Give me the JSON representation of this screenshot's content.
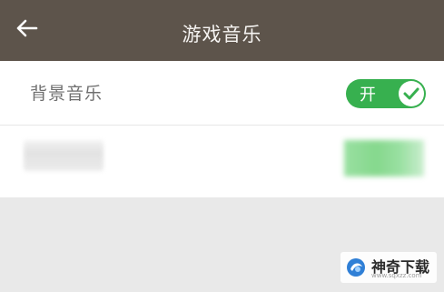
{
  "header": {
    "title": "游戏音乐",
    "back_icon": "arrow-left-icon"
  },
  "settings": {
    "items": [
      {
        "label": "背景音乐",
        "toggle_text": "开",
        "toggle_on": true,
        "check_icon": "check-icon"
      },
      {
        "label": "",
        "toggle_on": true
      }
    ]
  },
  "watermark": {
    "text": "神奇下载",
    "url": "www.sqxzz.com"
  },
  "colors": {
    "header_bg": "#5d544b",
    "toggle_on": "#37b04f",
    "toggle_blurred": "#7bd485"
  }
}
